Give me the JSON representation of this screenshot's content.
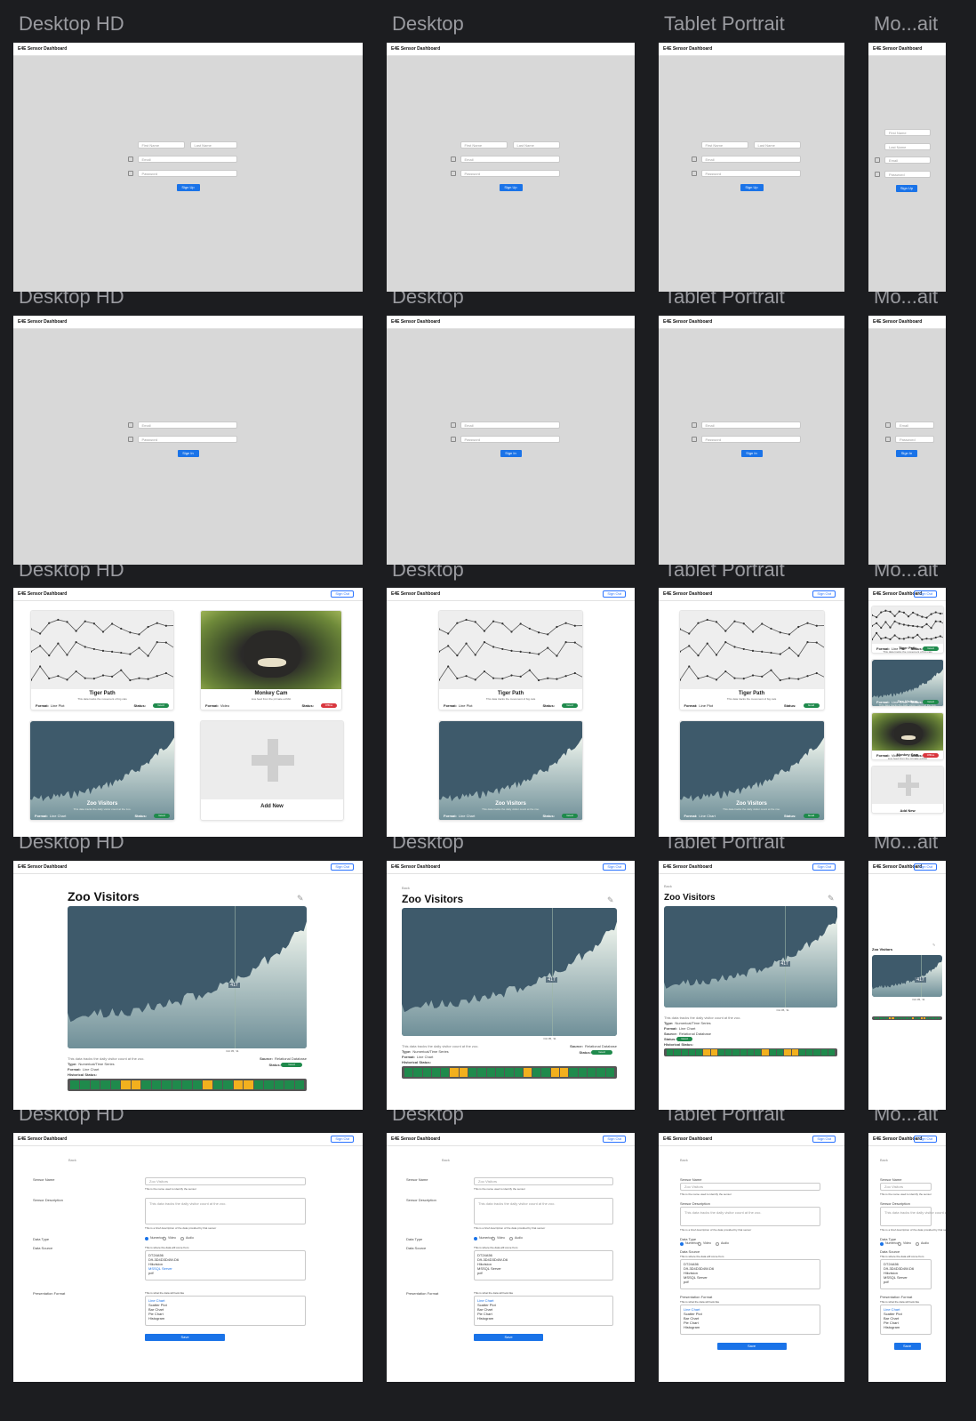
{
  "frame_labels": {
    "desktop_hd": "Desktop HD",
    "desktop": "Desktop",
    "tablet": "Tablet Portrait",
    "mobile": "Mo...ait"
  },
  "app": {
    "title": "E4E Sensor Dashboard",
    "sign_out": "Sign Out"
  },
  "signup": {
    "first_name": "First Name",
    "last_name": "Last Name",
    "email": "Email",
    "password": "Password",
    "button": "Sign Up"
  },
  "signin": {
    "email": "Email",
    "password": "Password",
    "button": "Sign In"
  },
  "dashboard": {
    "cards": [
      {
        "title": "Tiger Path",
        "desc": "This data tracks the movement of big cats",
        "format_label": "Format:",
        "format": "Line Plot",
        "status_label": "Status:",
        "status": "Good"
      },
      {
        "title": "Monkey Cam",
        "desc": "Live feed from the primate exhibit",
        "format_label": "Format:",
        "format": "Video",
        "status_label": "Status:",
        "status": "Offline"
      },
      {
        "title": "Zoo Visitors",
        "desc": "This data tracks the daily visitor count at the zoo.",
        "format_label": "Format:",
        "format": "Line Chart",
        "status_label": "Status:",
        "status": "Good"
      },
      {
        "title": "Add New"
      }
    ]
  },
  "detail": {
    "back": "Back",
    "title": "Zoo Visitors",
    "tooltip_value": "417",
    "date_label": "Oct 05, '11",
    "description": "This data tracks the daily visitor count at the zoo.",
    "type_label": "Type:",
    "type": "Numerical/Time Series",
    "format_label": "Format:",
    "format": "Line Chart",
    "source_label": "Source:",
    "source": "Relational Database",
    "status_label": "Status:",
    "status": "Good",
    "history_label": "Historical Status:",
    "history": [
      1,
      1,
      1,
      1,
      1,
      0,
      0,
      1,
      1,
      1,
      1,
      1,
      1,
      0,
      1,
      1,
      0,
      0,
      1,
      1,
      1,
      1,
      1
    ]
  },
  "form": {
    "back": "Back",
    "name_label": "Sensor Name",
    "name_value": "Zoo Visitors",
    "name_help": "This is the name used to identify the sensor",
    "desc_label": "Sensor Description",
    "desc_value": "This data tracks the daily visitor count at the zoo.",
    "desc_help": "This is a brief description of the data provided by that sensor",
    "type_label": "Data Type",
    "type_options": [
      "Numerical",
      "Video",
      "Audio"
    ],
    "source_label": "Data Source",
    "source_help": "This is where the data will come from",
    "sources": [
      "DT24A56",
      "D9-3D4D3D4W-D6",
      "Hikvision",
      "MSSQL Server",
      "pdf"
    ],
    "format_label": "Presentation Format",
    "format_help": "This is what the data will look like",
    "formats": [
      "Line Chart",
      "Scatter Plot",
      "Bar Chart",
      "Pie Chart",
      "Histogram"
    ],
    "save": "Save"
  },
  "colors": {
    "accent": "#1a73e8",
    "good": "#1f8a4c",
    "offline": "#d9363e",
    "warn": "#f2b01e",
    "chart_dark": "#3e5a6b",
    "chart_light": "#e2efe4"
  }
}
